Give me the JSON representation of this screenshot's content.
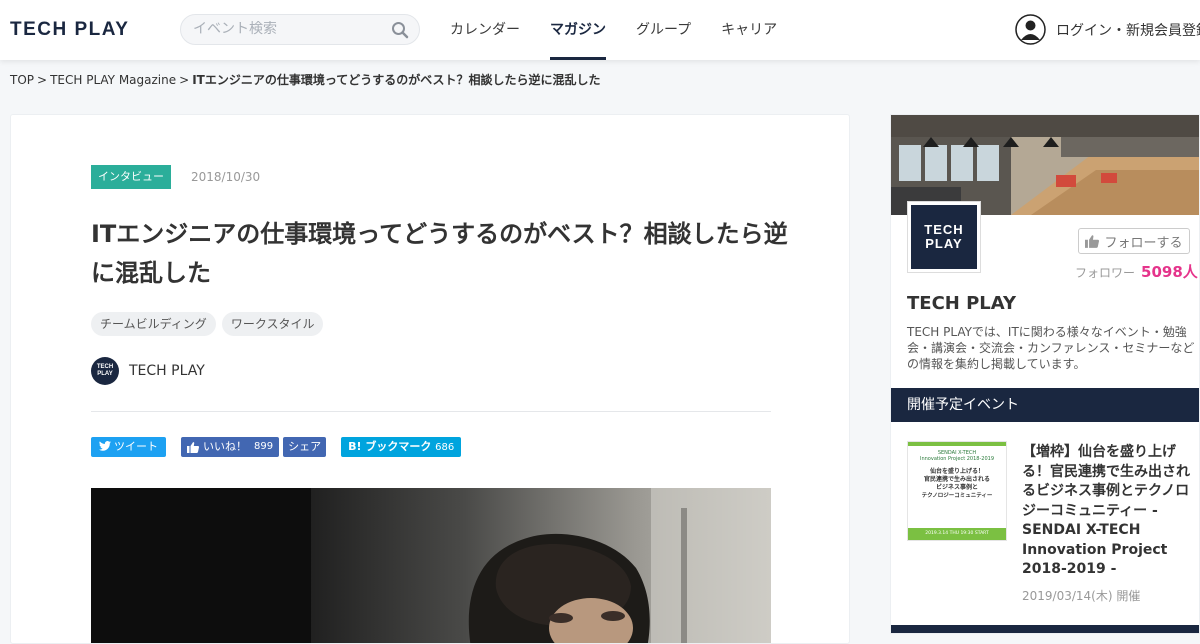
{
  "header": {
    "logo": "TECH PLAY",
    "search_placeholder": "イベント検索",
    "nav": [
      {
        "label": "カレンダー",
        "active": false
      },
      {
        "label": "マガジン",
        "active": true
      },
      {
        "label": "グループ",
        "active": false
      },
      {
        "label": "キャリア",
        "active": false
      }
    ],
    "login_label": "ログイン・新規会員登録"
  },
  "breadcrumb": {
    "items": [
      "TOP",
      "TECH PLAY Magazine"
    ],
    "separator": ">",
    "current": "ITエンジニアの仕事環境ってどうするのがベスト？相談したら逆に混乱した"
  },
  "article": {
    "category": "インタビュー",
    "date": "2018/10/30",
    "title": "ITエンジニアの仕事環境ってどうするのがベスト？相談したら逆に混乱した",
    "tags": [
      "チームビルディング",
      "ワークスタイル"
    ],
    "author": {
      "avatar_text": "TECH PLAY",
      "name": "TECH PLAY"
    },
    "share": {
      "tweet_label": "ツイート",
      "like_label": "いいね！",
      "like_count": "899",
      "fb_share_label": "シェア",
      "hatena_label": "B! ブックマーク",
      "hatena_count": "686"
    }
  },
  "sidebar": {
    "org_logo_text": "TECH PLAY",
    "follow_label": "フォローする",
    "followers_label": "フォロワー",
    "followers_count": "5098人",
    "org_name": "TECH PLAY",
    "org_description": "TECH PLAYでは、ITに関わる様々なイベント・勉強会・講演会・交流会・カンファレンス・セミナーなどの情報を集約し掲載しています。",
    "events_header": "開催予定イベント",
    "event": {
      "thumb": {
        "line1": "SENDAI X-TECH",
        "line2": "Innovation Project 2018-2019",
        "line3": "仙台を盛り上げる！",
        "line4": "官民連携で生み出される",
        "line5": "ビジネス事例と",
        "line6": "テクノロジーコミュニティー",
        "footer": "2019.3.14 THU 19:30 START"
      },
      "title": "【増枠】仙台を盛り上げる！官民連携で生み出されるビジネス事例とテクノロジーコミュニティー - SENDAI X-TECH Innovation Project 2018-2019 -",
      "date": "2019/03/14(木) 開催"
    }
  },
  "colors": {
    "navy": "#1a2740",
    "category_green": "#2bae9a",
    "followers_pink": "#e5348b",
    "twitter": "#1da1f2",
    "facebook": "#4267b2",
    "hatena": "#00a4de",
    "thumb_green": "#7bc042"
  }
}
